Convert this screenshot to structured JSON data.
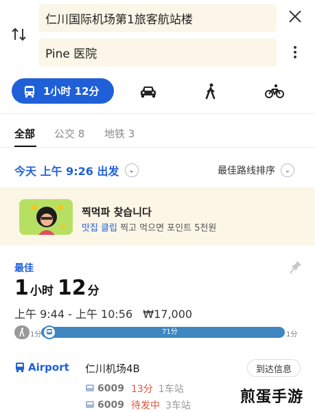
{
  "route": {
    "from": "仁川国际机场第1旅客航站楼",
    "to": "Pine 医院"
  },
  "modes": {
    "transit_label": "1小时 12分",
    "active": "transit",
    "icons": [
      "car-icon",
      "walk-icon",
      "bike-icon"
    ]
  },
  "filters": {
    "all": "全部",
    "bus": "公交 8",
    "subway": "地铁 3"
  },
  "depart": {
    "text": "今天 上午 9:26 出发",
    "sort": "最佳路线排序"
  },
  "banner": {
    "title": "찍먹파 찾습니다",
    "sub_accent": "맛집 클립",
    "sub_rest": " 찍고 먹으면 포인트 5천원"
  },
  "route_card": {
    "best": "最佳",
    "duration": {
      "h": "1",
      "h_unit": "小时",
      "m": "12",
      "m_unit": "分"
    },
    "times": "上午 9:44 - 上午 10:56",
    "fare": "₩17,000",
    "segments": {
      "walk_start": "1分",
      "ride": "71分",
      "walk_end": "1分"
    },
    "line_name": "Airport",
    "stop_name": "仁川机场4B",
    "arrival_button": "到达信息",
    "buses": [
      {
        "num": "6009",
        "wait": "13分",
        "stops": "1车站"
      },
      {
        "num": "6009",
        "wait": "待发中",
        "stops": "3车站"
      }
    ]
  },
  "colors": {
    "accent": "#1f60d9",
    "bar": "#3e87c1",
    "warn": "#e0533c",
    "banner_bg": "#fcf6e6"
  },
  "watermark": "煎蛋手游"
}
